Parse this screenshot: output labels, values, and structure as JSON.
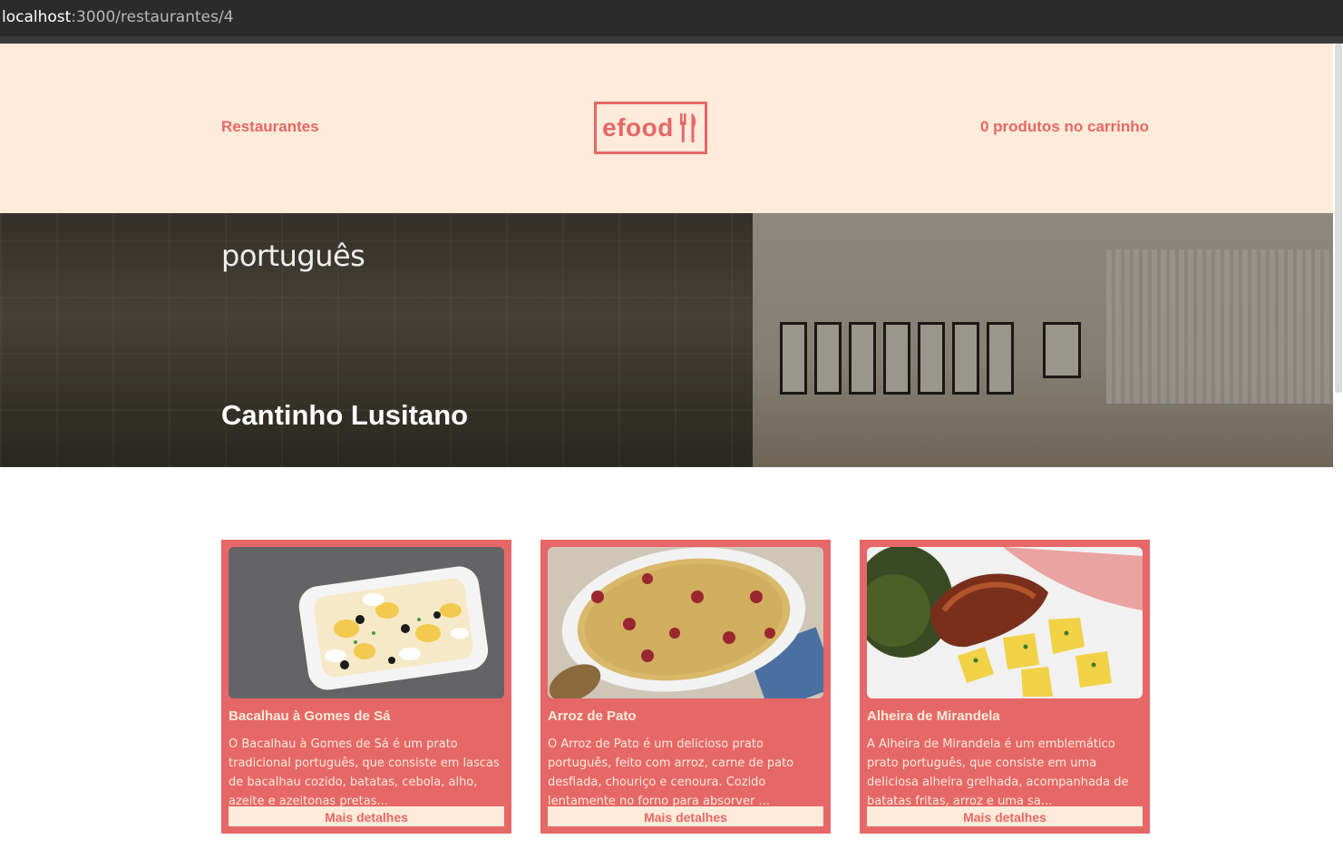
{
  "browser": {
    "url_host": "localhost",
    "url_path": ":3000/restaurantes/4"
  },
  "header": {
    "restaurants_link": "Restaurantes",
    "logo_text": "efood",
    "cart_text": "0 produtos no carrinho"
  },
  "banner": {
    "cuisine": "português",
    "restaurant_name": "Cantinho Lusitano"
  },
  "products": [
    {
      "title": "Bacalhau à Gomes de Sá",
      "description": "O Bacalhau à Gomes de Sá é um prato tradicional português, que consiste em lascas de bacalhau cozido, batatas, cebola, alho, azeite e azeitonas pretas...",
      "button": "Mais detalhes"
    },
    {
      "title": "Arroz de Pato",
      "description": "O Arroz de Pato é um delicioso prato português, feito com arroz, carne de pato desfiada, chouriço e cenoura. Cozido lentamente no forno para absorver ...",
      "button": "Mais detalhes"
    },
    {
      "title": "Alheira de Mirandela",
      "description": "A Alheira de Mirandela é um emblemático prato português, que consiste em uma deliciosa alheira grelhada, acompanhada de batatas fritas, arroz e uma sa...",
      "button": "Mais detalhes"
    }
  ],
  "colors": {
    "primary": "#e66767",
    "light": "#ffebd9"
  }
}
